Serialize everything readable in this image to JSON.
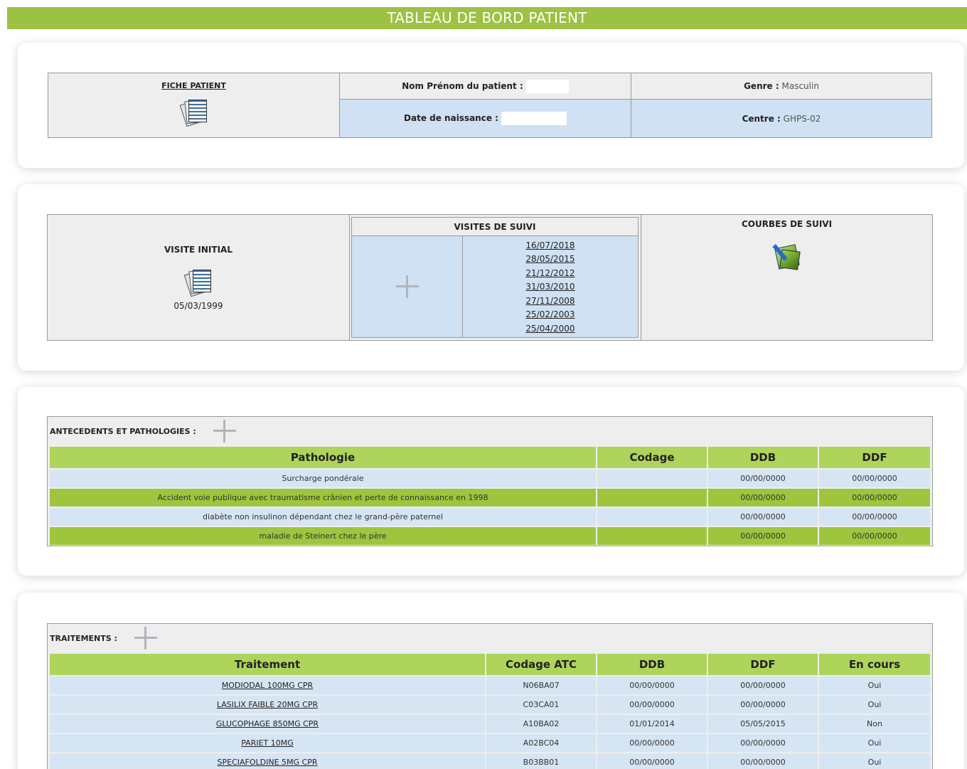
{
  "header": {
    "title": "TABLEAU DE BORD PATIENT"
  },
  "patient": {
    "fiche_label": "FICHE PATIENT",
    "fiche_icon": "patient-file-icon",
    "name_label": "Nom Prénom du patient :",
    "name_value": "",
    "birth_label": "Date de naissance :",
    "birth_value": "",
    "gender_label": "Genre :",
    "gender_value": "Masculin",
    "center_label": "Centre :",
    "center_value": "GHPS-02"
  },
  "visits": {
    "initial_label": "VISITE INITIAL",
    "initial_date": "05/03/1999",
    "followup_label": "VISITES DE SUIVI",
    "followup_dates": [
      "16/07/2018",
      "28/05/2015",
      "21/12/2012",
      "31/03/2010",
      "27/11/2008",
      "25/02/2003",
      "25/04/2000"
    ],
    "curves_label": "COURBES DE SUIVI",
    "curves_icon": "chart-curves-icon"
  },
  "antecedents": {
    "label": "ANTECEDENTS ET PATHOLOGIES :",
    "columns": [
      "Pathologie",
      "Codage",
      "DDB",
      "DDF"
    ],
    "rows": [
      [
        "Surcharge pondérale",
        "",
        "00/00/0000",
        "00/00/0000"
      ],
      [
        "Accident voie publique avec traumatisme crânien et perte de connaissance en 1998",
        "",
        "00/00/0000",
        "00/00/0000"
      ],
      [
        "diabète non insulinon dépendant chez le grand-père paternel",
        "",
        "00/00/0000",
        "00/00/0000"
      ],
      [
        "maladie de Steinert chez le père",
        "",
        "00/00/0000",
        "00/00/0000"
      ]
    ]
  },
  "traitements": {
    "label": "TRAITEMENTS :",
    "columns": [
      "Traitement",
      "Codage ATC",
      "DDB",
      "DDF",
      "En cours"
    ],
    "rows": [
      [
        "MODIODAL 100MG CPR",
        "N06BA07",
        "00/00/0000",
        "00/00/0000",
        "Oui"
      ],
      [
        "LASILIX FAIBLE 20MG CPR",
        "C03CA01",
        "00/00/0000",
        "00/00/0000",
        "Oui"
      ],
      [
        "GLUCOPHAGE 850MG CPR",
        "A10BA02",
        "01/01/2014",
        "05/05/2015",
        "Non"
      ],
      [
        "PARIET 10MG",
        "A02BC04",
        "00/00/0000",
        "00/00/0000",
        "Oui"
      ],
      [
        "SPECIAFOLDINE 5MG CPR",
        "B03BB01",
        "00/00/0000",
        "00/00/0000",
        "Oui"
      ]
    ]
  },
  "colors": {
    "green_header": "#9dc142",
    "light_green": "#aed45c",
    "row_blue": "#d6e5f3",
    "row_green": "#9ec53d"
  }
}
